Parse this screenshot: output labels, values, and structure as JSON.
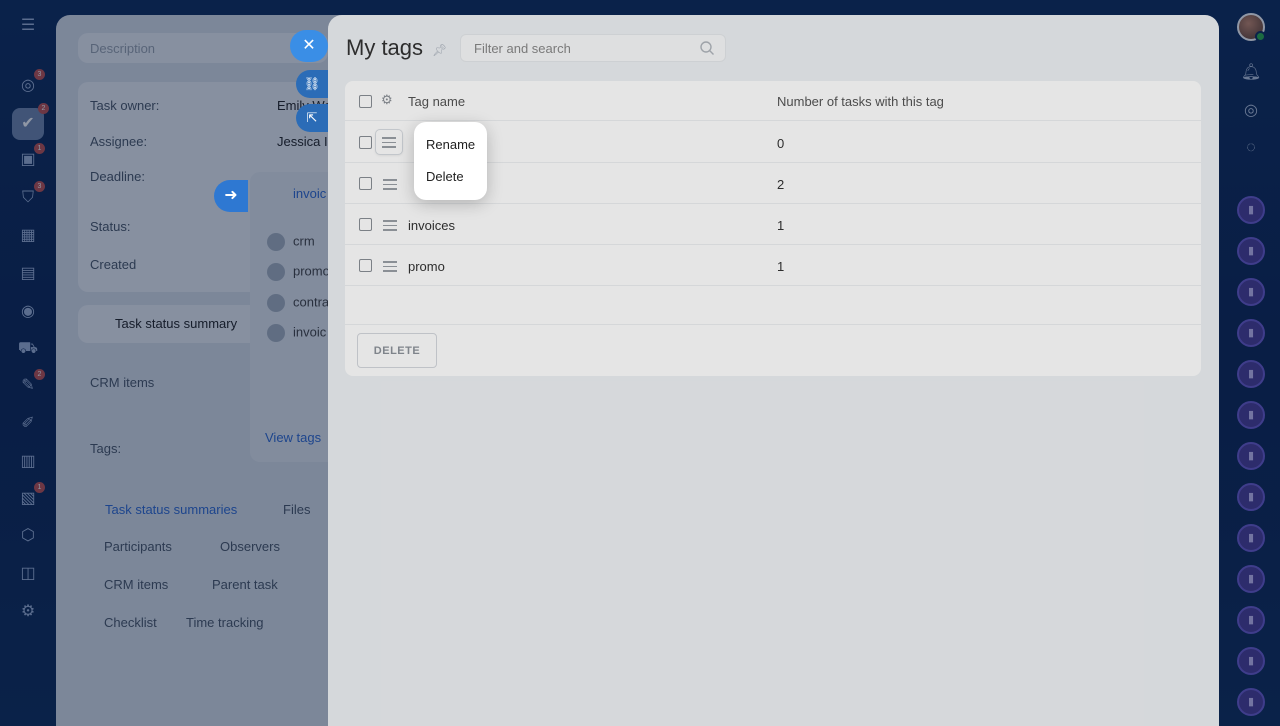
{
  "background_card": {
    "description_label": "Description",
    "task_owner_label": "Task owner:",
    "task_owner_value": "Emily We",
    "assignee_label": "Assignee:",
    "assignee_value": "Jessica I",
    "deadline_label": "Deadline:",
    "status_label": "Status:",
    "created_label": "Created",
    "task_status_summary": "Task status summary",
    "crm_items_label": "CRM items",
    "tags_label": "Tags:",
    "tag_input_value": "invoic",
    "tag_options": [
      "crm",
      "promo",
      "contra",
      "invoic"
    ],
    "view_tags": "View tags",
    "bottom_tabs": [
      "Task status summaries",
      "Files",
      "Participants",
      "Observers",
      "CRM items",
      "Parent task",
      "Checklist",
      "Time tracking"
    ]
  },
  "panel": {
    "title": "My tags",
    "search_placeholder": "Filter and search",
    "columns": {
      "name": "Tag name",
      "count": "Number of tasks with this tag"
    },
    "rows": [
      {
        "name": "",
        "count": "0"
      },
      {
        "name": "",
        "count": "2"
      },
      {
        "name": "invoices",
        "count": "1"
      },
      {
        "name": "promo",
        "count": "1"
      }
    ],
    "delete_button": "DELETE"
  },
  "context_menu": {
    "items": [
      "Rename",
      "Delete"
    ]
  },
  "nav_badges": [
    "3",
    "2",
    "1",
    "3",
    "2",
    "1"
  ]
}
